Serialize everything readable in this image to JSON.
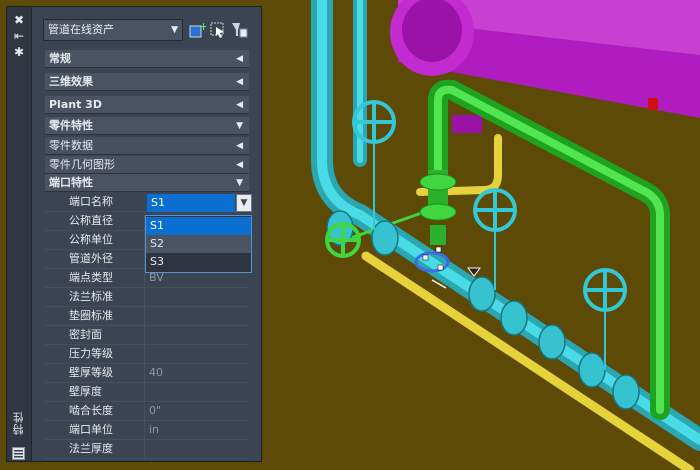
{
  "panel": {
    "title": "特性",
    "strip_buttons": [
      "close-icon",
      "auto-hide-icon",
      "settings-icon"
    ],
    "selector": {
      "value": "管道在线资产"
    },
    "categories": [
      {
        "label": "常规",
        "state": "collapsed"
      },
      {
        "label": "三维效果",
        "state": "collapsed"
      },
      {
        "label": "Plant 3D",
        "state": "collapsed"
      },
      {
        "label": "零件特性",
        "state": "expanded"
      },
      {
        "label": "零件数据",
        "state": "collapsed"
      },
      {
        "label": "零件几何图形",
        "state": "collapsed"
      },
      {
        "label": "端口特性",
        "state": "expanded"
      }
    ],
    "properties": [
      {
        "name": "端口名称",
        "value": "S1"
      },
      {
        "name": "公称直径",
        "value": ""
      },
      {
        "name": "公称单位",
        "value": ""
      },
      {
        "name": "管道外径",
        "value": ""
      },
      {
        "name": "端点类型",
        "value": "BV"
      },
      {
        "name": "法兰标准",
        "value": ""
      },
      {
        "name": "垫圈标准",
        "value": ""
      },
      {
        "name": "密封面",
        "value": ""
      },
      {
        "name": "压力等级",
        "value": ""
      },
      {
        "name": "壁厚等级",
        "value": "40"
      },
      {
        "name": "壁厚度",
        "value": ""
      },
      {
        "name": "啮合长度",
        "value": "0\""
      },
      {
        "name": "端口单位",
        "value": "in"
      },
      {
        "name": "法兰厚度",
        "value": ""
      }
    ],
    "dropdown_options": [
      "S1",
      "S2",
      "S3"
    ]
  },
  "colors": {
    "background": "#5c4a06",
    "vessel": "#b81cc4",
    "pipe_cyan": "#33c8d4",
    "pipe_green": "#3fd63f",
    "pipe_yellow": "#e6d23a",
    "selection": "#0a6fd0"
  }
}
